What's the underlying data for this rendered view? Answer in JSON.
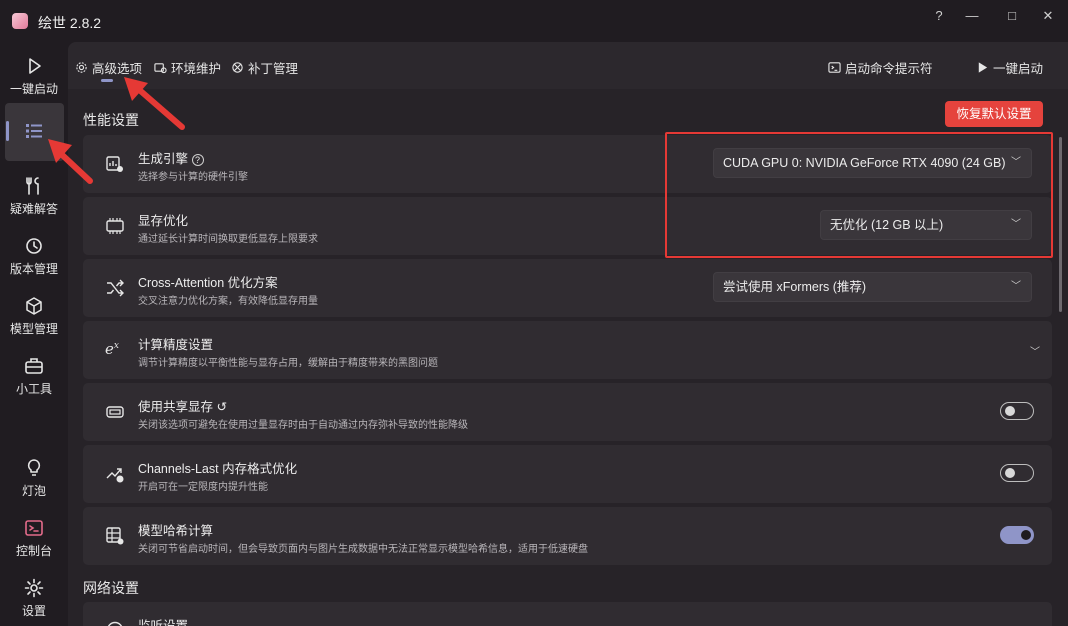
{
  "window": {
    "title": "绘世 2.8.2",
    "controls": [
      "?",
      "—",
      "□",
      "✕"
    ]
  },
  "nav": {
    "items": [
      {
        "label": "一键启动",
        "icon": "play-icon"
      },
      {
        "label": "",
        "icon": "list-icon",
        "selected": true
      },
      {
        "label": "疑难解答",
        "icon": "tools-icon"
      },
      {
        "label": "版本管理",
        "icon": "history-icon"
      },
      {
        "label": "模型管理",
        "icon": "cube-icon"
      },
      {
        "label": "小工具",
        "icon": "toolbox-icon"
      },
      {
        "label": "灯泡",
        "icon": "lightbulb-icon"
      },
      {
        "label": "控制台",
        "icon": "console-icon"
      },
      {
        "label": "设置",
        "icon": "gear-icon"
      }
    ]
  },
  "tabs": [
    {
      "label": "高级选项",
      "icon": "gear-icon",
      "active": true
    },
    {
      "label": "环境维护",
      "icon": "maintenance-icon"
    },
    {
      "label": "补丁管理",
      "icon": "patch-icon"
    }
  ],
  "toolbar": {
    "cmd_label": "启动命令提示符",
    "launch_label": "一键启动"
  },
  "performance": {
    "title": "性能设置",
    "reset_label": "恢复默认设置",
    "items": [
      {
        "title": "生成引擎",
        "desc": "选择参与计算的硬件引擎",
        "value": "CUDA GPU 0: NVIDIA GeForce RTX 4090 (24 GB)",
        "control": "select"
      },
      {
        "title": "显存优化",
        "desc": "通过延长计算时间换取更低显存上限要求",
        "value": "无优化 (12 GB 以上)",
        "control": "select"
      },
      {
        "title": "Cross-Attention 优化方案",
        "desc": "交叉注意力优化方案，有效降低显存用量",
        "value": "尝试使用 xFormers (推荐)",
        "control": "select"
      },
      {
        "title": "计算精度设置",
        "desc": "调节计算精度以平衡性能与显存占用，缓解由于精度带来的黑图问题",
        "control": "expand"
      },
      {
        "title": "使用共享显存",
        "desc": "关闭该选项可避免在使用过量显存时由于自动通过内存弥补导致的性能降级",
        "control": "toggle",
        "on": false
      },
      {
        "title": "Channels-Last 内存格式优化",
        "desc": "开启可在一定限度内提升性能",
        "control": "toggle",
        "on": false
      },
      {
        "title": "模型哈希计算",
        "desc": "关闭可节省启动时间，但会导致页面内与图片生成数据中无法正常显示模型哈希信息，适用于低速硬盘",
        "control": "toggle",
        "on": true
      }
    ]
  },
  "network": {
    "title": "网络设置",
    "items": [
      {
        "title": "监听设置"
      }
    ]
  },
  "colors": {
    "accent": "#8f95c8",
    "danger": "#e5433d",
    "annotation": "#e53935"
  }
}
